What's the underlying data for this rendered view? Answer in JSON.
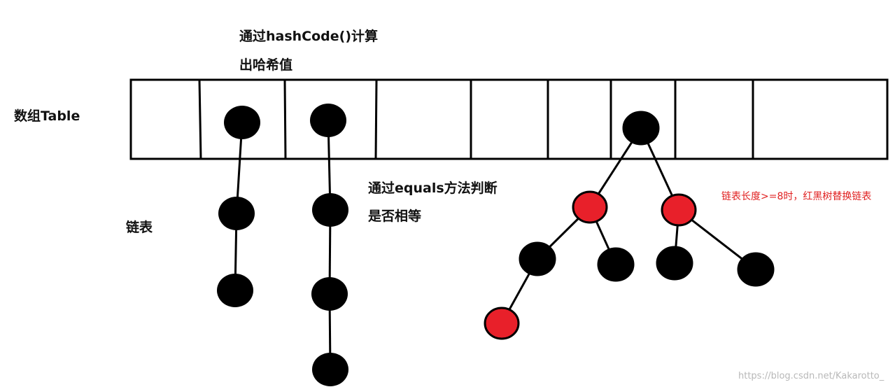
{
  "labels": {
    "hash_line1": "通过hashCode()计算",
    "hash_line2": "出哈希值",
    "array_label": "数组Table",
    "list_label": "链表",
    "equals_line1": "通过equals方法判断",
    "equals_line2": "是否相等",
    "tree_note": "链表长度>=8时，红黑树替换链表"
  },
  "watermark": "https://blog.csdn.net/Kakarotto_",
  "colors": {
    "line": "#000000",
    "node_black": "#000000",
    "node_red": "#e8202a",
    "note_red": "#e02020",
    "watermark": "#b8b8b8"
  },
  "array_table": {
    "slot_count": 9
  }
}
